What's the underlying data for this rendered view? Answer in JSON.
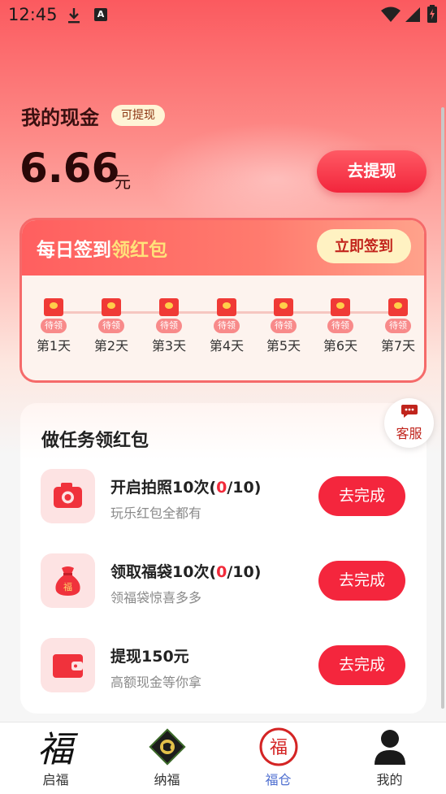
{
  "status_bar": {
    "time": "12:45",
    "a_badge": "A"
  },
  "cash": {
    "title": "我的现金",
    "badge": "可提现",
    "amount": "6.66",
    "unit": "元",
    "withdraw_button": "去提现"
  },
  "signin": {
    "title_main": "每日签到",
    "title_highlight": "领红包",
    "button": "立即签到",
    "days": [
      {
        "status": "待领",
        "label": "第1天"
      },
      {
        "status": "待领",
        "label": "第2天"
      },
      {
        "status": "待领",
        "label": "第3天"
      },
      {
        "status": "待领",
        "label": "第4天"
      },
      {
        "status": "待领",
        "label": "第5天"
      },
      {
        "status": "待领",
        "label": "第6天"
      },
      {
        "status": "待领",
        "label": "第7天"
      }
    ]
  },
  "tasks": {
    "title": "做任务领红包",
    "items": [
      {
        "name_prefix": "开启拍照10次(",
        "progress": "0",
        "name_suffix": "/10)",
        "desc": "玩乐红包全都有",
        "button": "去完成",
        "icon": "camera-icon"
      },
      {
        "name_prefix": "领取福袋10次(",
        "progress": "0",
        "name_suffix": "/10)",
        "desc": "领福袋惊喜多多",
        "button": "去完成",
        "icon": "lucky-bag-icon",
        "icon_text": "福"
      },
      {
        "name_prefix": "提现150元",
        "progress": "",
        "name_suffix": "",
        "desc": "高额现金等你拿",
        "button": "去完成",
        "icon": "wallet-icon"
      }
    ]
  },
  "service": {
    "label": "客服"
  },
  "nav": {
    "items": [
      {
        "label": "启福",
        "icon": "fu-calligraphy-icon",
        "glyph": "福"
      },
      {
        "label": "纳福",
        "icon": "diamond-emblem-icon"
      },
      {
        "label": "福仓",
        "icon": "fu-circle-icon",
        "glyph": "福",
        "active": true
      },
      {
        "label": "我的",
        "icon": "person-icon"
      }
    ]
  },
  "colors": {
    "accent": "#f4263d",
    "active_nav": "#4f6fd0",
    "highlight": "#ffe27a"
  }
}
